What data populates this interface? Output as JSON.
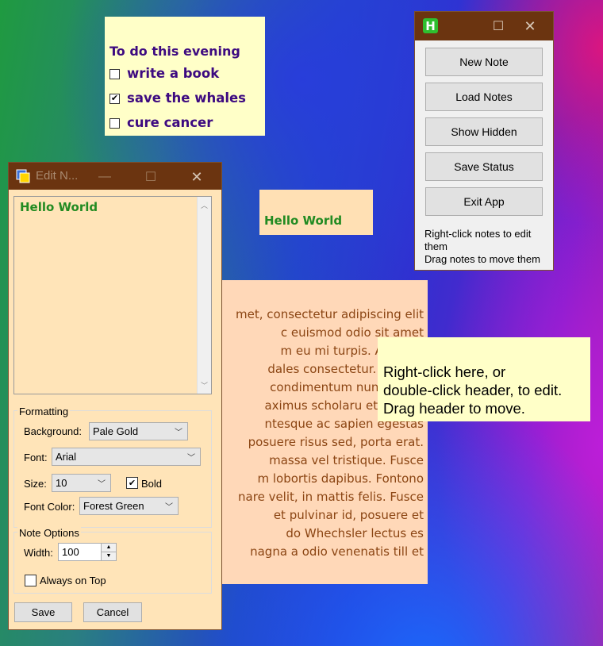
{
  "todo_note": {
    "title": "To do this evening",
    "items": [
      {
        "label": "write a book",
        "checked": false
      },
      {
        "label": "save the whales",
        "checked": true
      },
      {
        "label": "cure cancer",
        "checked": false
      }
    ],
    "colors": {
      "background": "#ffffc8",
      "text": "#3d0a80"
    }
  },
  "hello_note": {
    "text": "Hello World",
    "colors": {
      "background": "#ffe0b4",
      "text": "#228b22"
    }
  },
  "lorem_note": {
    "lines": [
      "met, consectetur adipiscing elit",
      "c euismod odio sit amet",
      "m eu mi turpis. Aliquam",
      "dales consectetur. Curabit",
      "condimentum nunc tristiq",
      "aximus scholaru et psycho",
      "ntesque ac sapien egestas",
      "posuere risus sed, porta erat.",
      "massa vel tristique. Fusce",
      "m lobortis dapibus. Fontono",
      "nare velit, in mattis felis. Fusce",
      "et pulvinar id, posuere et",
      "do Whechsler lectus es",
      "nagna a odio venenatis till et"
    ],
    "colors": {
      "background": "#ffd8b8",
      "text": "#8b4513"
    }
  },
  "instruction_note": {
    "lines": [
      "Right-click here, or",
      "double-click header, to edit.",
      "Drag header to move."
    ]
  },
  "app_window": {
    "icon_letter": "H",
    "buttons": [
      "New Note",
      "Load Notes",
      "Show Hidden",
      "Save Status",
      "Exit App"
    ],
    "help_lines": [
      "Right-click notes to edit",
      "them",
      "Drag notes to move them"
    ],
    "titlebar_color": "#6b3410"
  },
  "edit_window": {
    "title": "Edit N...",
    "editor_text": "Hello World",
    "formatting_label": "Formatting",
    "background_label": "Background:",
    "background_value": "Pale Gold",
    "font_label": "Font:",
    "font_value": "Arial",
    "size_label": "Size:",
    "size_value": "10",
    "bold_label": "Bold",
    "bold_checked": true,
    "font_color_label": "Font Color:",
    "font_color_value": "Forest Green",
    "note_options_label": "Note Options",
    "width_label": "Width:",
    "width_value": "100",
    "always_on_top_label": "Always on Top",
    "always_on_top_checked": false,
    "save_label": "Save",
    "cancel_label": "Cancel"
  }
}
